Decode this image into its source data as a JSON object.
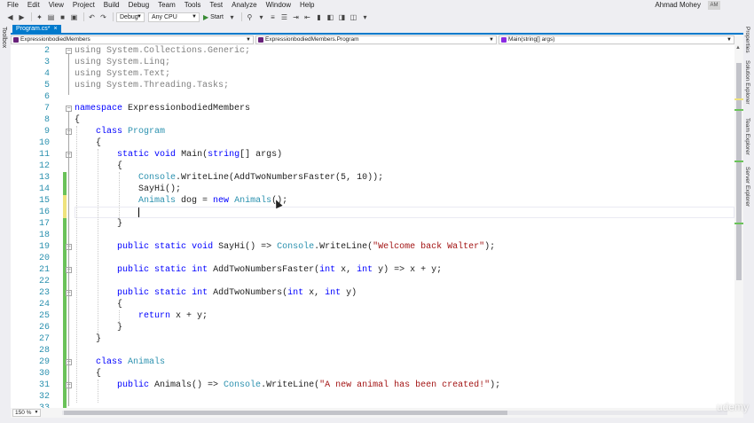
{
  "menu": [
    "File",
    "Edit",
    "View",
    "Project",
    "Build",
    "Debug",
    "Team",
    "Tools",
    "Test",
    "Analyze",
    "Window",
    "Help"
  ],
  "user": {
    "name": "Ahmad Mohey",
    "initials": "AM"
  },
  "toolbar": {
    "config": "Debug",
    "platform": "Any CPU",
    "start_label": "Start"
  },
  "sidepanel": {
    "left": "Toolbox",
    "right": [
      "Properties",
      "Solution Explorer",
      "Team Explorer",
      "Server Explorer"
    ]
  },
  "tab": {
    "label": "Program.cs*",
    "close": "×"
  },
  "nav": {
    "project": "ExpressionbodiedMembers",
    "type": "ExpressionbodiedMembers.Program",
    "member": "Main(string[] args)"
  },
  "editor": {
    "line_numbers": [
      "2",
      "3",
      "4",
      "5",
      "6",
      "7",
      "8",
      "9",
      "10",
      "11",
      "12",
      "13",
      "14",
      "15",
      "16",
      "17",
      "18",
      "19",
      "20",
      "21",
      "22",
      "23",
      "24",
      "25",
      "26",
      "27",
      "28",
      "29",
      "30",
      "31",
      "32",
      "33"
    ],
    "lines": [
      "using System.Collections.Generic;",
      "using System.Linq;",
      "using System.Text;",
      "using System.Threading.Tasks;",
      "",
      "namespace ExpressionbodiedMembers",
      "{",
      "    class Program",
      "    {",
      "        static void Main(string[] args)",
      "        {",
      "            Console.WriteLine(AddTwoNumbersFaster(5, 10));",
      "            SayHi();",
      "            Animals dog = new Animals();",
      "",
      "        }",
      "",
      "        public static void SayHi() => Console.WriteLine(\"Welcome back Walter\");",
      "",
      "        public static int AddTwoNumbersFaster(int x, int y) => x + y;",
      "",
      "        public static int AddTwoNumbers(int x, int y)",
      "        {",
      "            return x + y;",
      "        }",
      "    }",
      "",
      "    class Animals",
      "    {",
      "        public Animals() => Console.WriteLine(\"A new animal has been created!\");",
      "",
      ""
    ]
  },
  "zoom": "150 %",
  "watermark": "udemy",
  "colors": {
    "keyword": "#0000ff",
    "type": "#2b91af",
    "string": "#a31515",
    "using_dim": "#808080",
    "line_number": "#2b91af",
    "saved_change": "#6ac259",
    "unsaved_change": "#efe37d",
    "accent": "#007acc"
  }
}
